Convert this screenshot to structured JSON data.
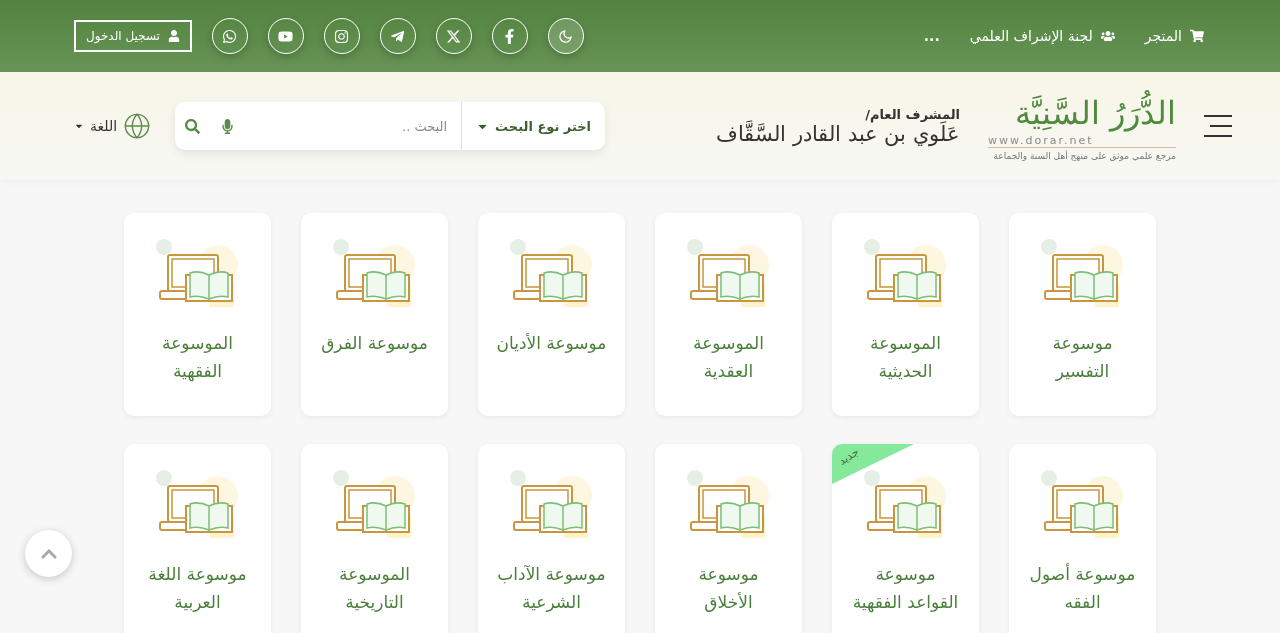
{
  "top_bar": {
    "links": [
      {
        "kind": "store",
        "label": "المتجر"
      },
      {
        "kind": "committee",
        "label": "لجنة الإشراف العلمي"
      }
    ],
    "more": "...",
    "social": [
      {
        "kind": "moon"
      },
      {
        "kind": "facebook"
      },
      {
        "kind": "x"
      },
      {
        "kind": "telegram"
      },
      {
        "kind": "instagram"
      },
      {
        "kind": "youtube"
      },
      {
        "kind": "whatsapp"
      }
    ],
    "login": "تسجيل الدخول"
  },
  "header": {
    "logo": {
      "title": "الدُّرَرُ السَّنِيَّة",
      "url": "www.dorar.net",
      "tagline": "مرجع علمي موثق على منهج أهل السنة والجماعة"
    },
    "supervisor": {
      "label": "المشرف العام/",
      "name": "عَلَوي بن عبد القادر السَّقَّاف"
    },
    "search": {
      "type_label": "اختر نوع البحث",
      "placeholder": "البحث .."
    },
    "language": "اللغة"
  },
  "cards": [
    {
      "title": "موسوعة التفسير",
      "new": false
    },
    {
      "title": "الموسوعة الحديثية",
      "new": false
    },
    {
      "title": "الموسوعة العقدية",
      "new": false
    },
    {
      "title": "موسوعة الأديان",
      "new": false
    },
    {
      "title": "موسوعة الفرق",
      "new": false
    },
    {
      "title": "الموسوعة الفقهية",
      "new": false
    },
    {
      "title": "موسوعة أصول الفقه",
      "new": false
    },
    {
      "title": "موسوعة القواعد الفقهية",
      "new": true,
      "badge": "جديد"
    },
    {
      "title": "موسوعة الأخلاق",
      "new": false
    },
    {
      "title": "موسوعة الآداب الشرعية",
      "new": false
    },
    {
      "title": "الموسوعة التاريخية",
      "new": false
    },
    {
      "title": "موسوعة اللغة العربية",
      "new": false
    }
  ]
}
